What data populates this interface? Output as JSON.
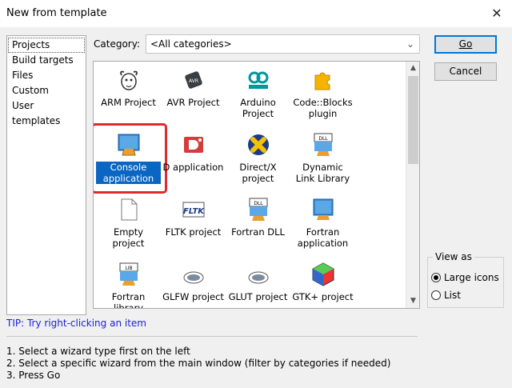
{
  "window": {
    "title": "New from template",
    "close_glyph": "✕"
  },
  "sidebar": {
    "items": [
      {
        "label": "Projects",
        "selected": true
      },
      {
        "label": "Build targets"
      },
      {
        "label": "Files"
      },
      {
        "label": "Custom"
      },
      {
        "label": "User templates"
      }
    ]
  },
  "category": {
    "label": "Category:",
    "value": "<All categories>"
  },
  "templates": [
    {
      "label": "ARM Project",
      "icon": "gnu-icon"
    },
    {
      "label": "AVR Project",
      "icon": "avr-chip-icon"
    },
    {
      "label": "Arduino Project",
      "icon": "arduino-icon"
    },
    {
      "label": "Code::Blocks plugin",
      "icon": "puzzle-piece-icon"
    },
    {
      "label": "Console application",
      "icon": "console-monitor-icon",
      "selected": true
    },
    {
      "label": "D application",
      "icon": "d-language-icon"
    },
    {
      "label": "Direct/X project",
      "icon": "directx-icon"
    },
    {
      "label": "Dynamic Link Library",
      "icon": "dll-icon"
    },
    {
      "label": "Empty project",
      "icon": "empty-document-icon"
    },
    {
      "label": "FLTK project",
      "icon": "fltk-icon"
    },
    {
      "label": "Fortran DLL",
      "icon": "fortran-dll-icon"
    },
    {
      "label": "Fortran application",
      "icon": "fortran-app-icon"
    },
    {
      "label": "Fortran library",
      "icon": "fortran-lib-icon"
    },
    {
      "label": "GLFW project",
      "icon": "glfw-icon"
    },
    {
      "label": "GLUT project",
      "icon": "glut-icon"
    },
    {
      "label": "GTK+ project",
      "icon": "gtk-icon"
    }
  ],
  "buttons": {
    "go": "Go",
    "cancel": "Cancel"
  },
  "view_as": {
    "title": "View as",
    "large_icons": "Large icons",
    "list": "List",
    "selected": "large_icons"
  },
  "tip": "TIP: Try right-clicking an item",
  "instructions": [
    "1. Select a wizard type first on the left",
    "2. Select a specific wizard from the main window (filter by categories if needed)",
    "3. Press Go"
  ],
  "colors": {
    "selection": "#0a66c2",
    "highlight_box": "#e0282e",
    "default_button_border": "#0078d7",
    "tip_text": "#1c1ce0"
  }
}
